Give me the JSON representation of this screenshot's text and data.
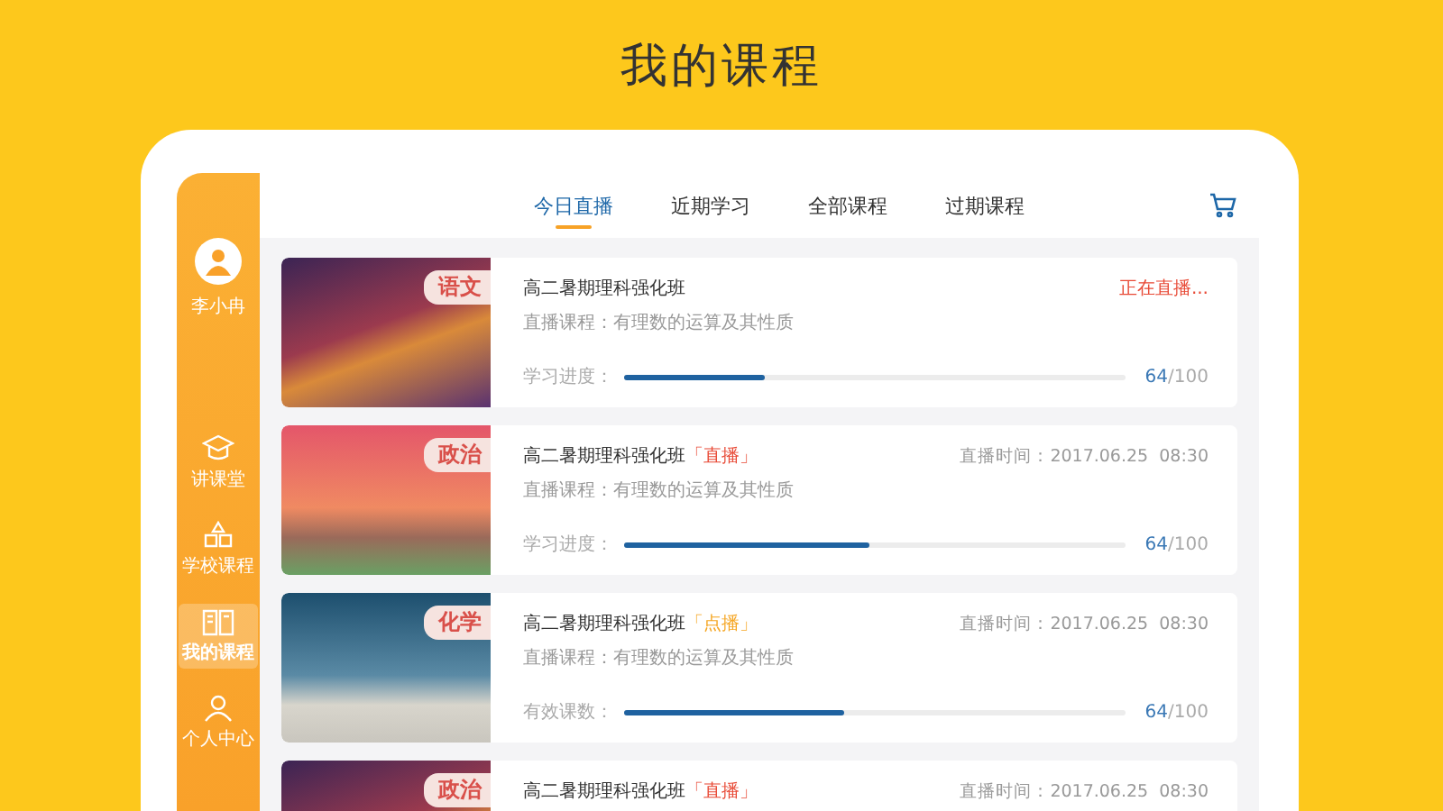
{
  "page_title": "我的课程",
  "sidebar": {
    "user": {
      "name": "李小冉"
    },
    "items": [
      {
        "label": "讲课堂",
        "kind": "cap",
        "selected": false
      },
      {
        "label": "学校课程",
        "kind": "blocks",
        "selected": false
      },
      {
        "label": "我的课程",
        "kind": "book",
        "selected": true
      },
      {
        "label": "个人中心",
        "kind": "person",
        "selected": false
      }
    ]
  },
  "tabs": [
    {
      "label": "今日直播",
      "selected": true
    },
    {
      "label": "近期学习",
      "selected": false
    },
    {
      "label": "全部课程",
      "selected": false
    },
    {
      "label": "过期课程",
      "selected": false
    }
  ],
  "courses": [
    {
      "subject": "语文",
      "title": "高二暑期理科强化班",
      "status": {
        "kind": "live",
        "text": "正在直播..."
      },
      "subtitle": "直播课程：有理数的运算及其性质",
      "progress": {
        "label": "学习进度：",
        "level": 0.28,
        "reading": "**64**/100"
      }
    },
    {
      "subject": "政治",
      "title": "高二暑期理科强化班",
      "tag": {
        "kind": "live",
        "text": "「直播」"
      },
      "status": {
        "kind": "time",
        "text": "直播时间：2017.06.25  08:30"
      },
      "subtitle": "直播课程：有理数的运算及其性质",
      "progress": {
        "label": "学习进度：",
        "level": 0.49,
        "reading": "**64**/100"
      }
    },
    {
      "subject": "化学",
      "title": "高二暑期理科强化班",
      "tag": {
        "kind": "vod",
        "text": "「点播」"
      },
      "status": {
        "kind": "time",
        "text": "直播时间：2017.06.25  08:30"
      },
      "subtitle": "直播课程：有理数的运算及其性质",
      "progress": {
        "label": "有效课数：",
        "level": 0.44,
        "reading": "**64**/100"
      }
    },
    {
      "subject": "政治",
      "title": "高二暑期理科强化班",
      "tag": {
        "kind": "live",
        "text": "「直播」"
      },
      "status": {
        "kind": "time",
        "text": "直播时间：2017.06.25  08:30"
      }
    }
  ]
}
